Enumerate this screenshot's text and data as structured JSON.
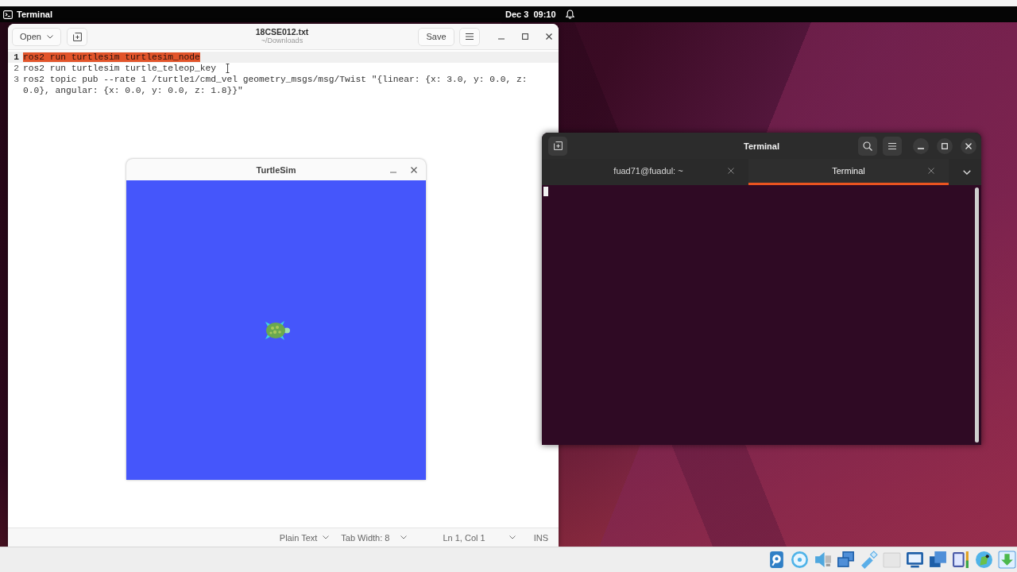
{
  "top_bar": {
    "app_name": "Terminal",
    "clock": "Dec 3  09:10"
  },
  "editor": {
    "open_button": "Open",
    "title": "18CSE012.txt",
    "subtitle": "~/Downloads",
    "save_button": "Save",
    "lines": [
      {
        "number": "1",
        "text": "ros2 run turtlesim turtlesim_node",
        "selected": true
      },
      {
        "number": "2",
        "text": "ros2 run turtlesim turtle_teleop_key",
        "selected": false
      },
      {
        "number": "3",
        "text": "ros2 topic pub --rate 1 /turtle1/cmd_vel geometry_msgs/msg/Twist \"{linear: {x: 3.0, y: 0.0, z: 0.0}, angular: {x: 0.0, y: 0.0, z: 1.8}}\"",
        "selected": false
      }
    ],
    "status_bar": {
      "language": "Plain Text",
      "tab_width": "Tab Width: 8",
      "position": "Ln 1, Col 1",
      "mode": "INS"
    }
  },
  "turtlesim": {
    "title": "TurtleSim"
  },
  "terminal": {
    "title": "Terminal",
    "tabs": [
      {
        "label": "fuad71@fuadul: ~",
        "selected": false
      },
      {
        "label": "Terminal",
        "selected": true
      }
    ]
  }
}
